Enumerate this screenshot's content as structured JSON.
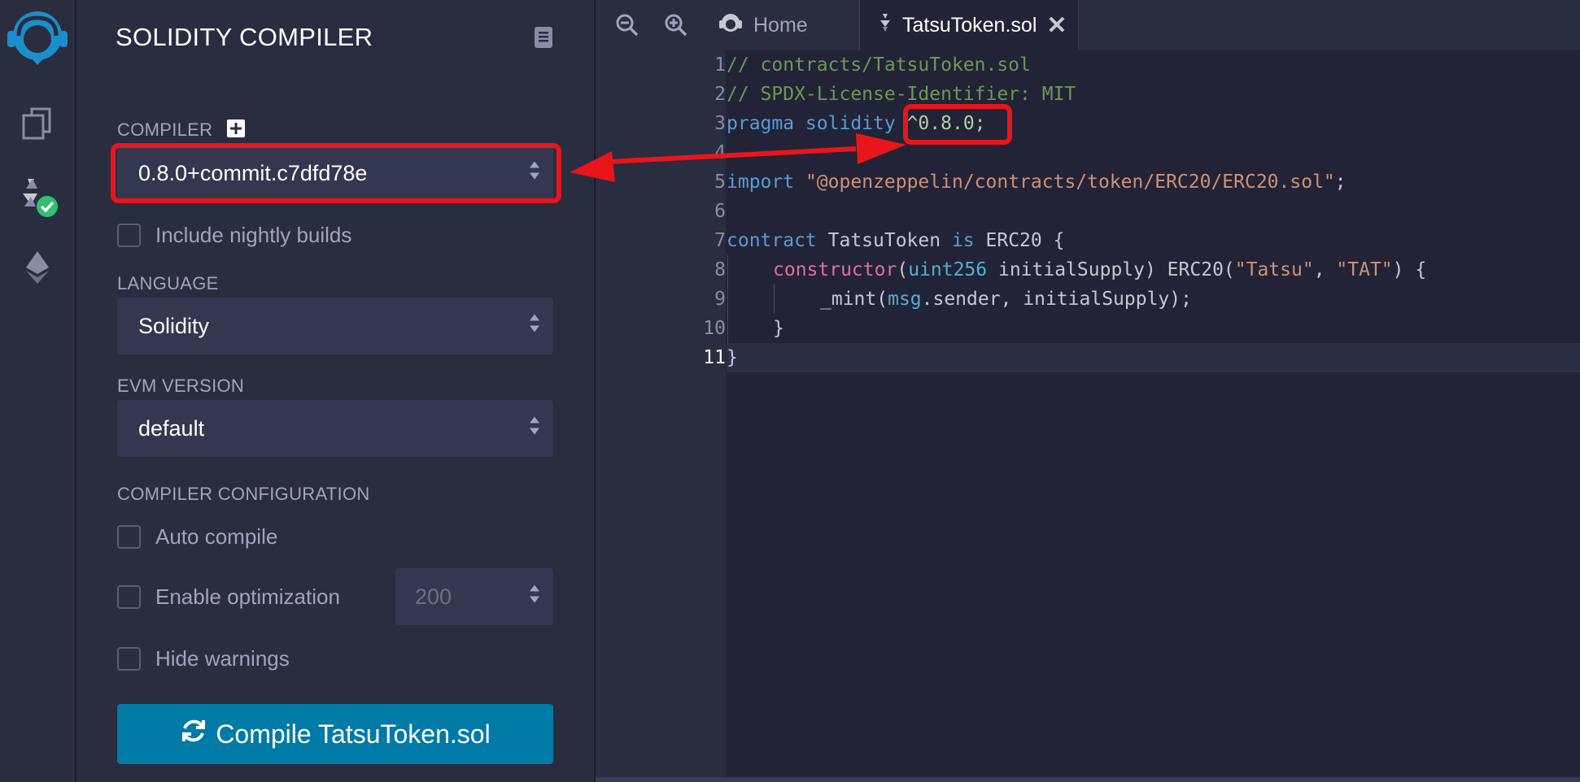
{
  "side_panel": {
    "title": "SOLIDITY COMPILER",
    "compiler_label": "COMPILER",
    "compiler_version": "0.8.0+commit.c7dfd78e",
    "nightly_label": "Include nightly builds",
    "language_label": "LANGUAGE",
    "language_value": "Solidity",
    "evm_label": "EVM VERSION",
    "evm_value": "default",
    "config_label": "COMPILER CONFIGURATION",
    "auto_compile_label": "Auto compile",
    "optimization_label": "Enable optimization",
    "optimization_runs": "200",
    "hide_warnings_label": "Hide warnings",
    "compile_button": "Compile TatsuToken.sol"
  },
  "tabs": {
    "home": "Home",
    "file": "TatsuToken.sol"
  },
  "editor": {
    "line_numbers": [
      "1",
      "2",
      "3",
      "4",
      "5",
      "6",
      "7",
      "8",
      "9",
      "10",
      "11"
    ],
    "line1": "// contracts/TatsuToken.sol",
    "line2": "// SPDX-License-Identifier: MIT",
    "line3_kw": "pragma solidity",
    "line3_ver": "^0.8.0;",
    "line5_kw": "import",
    "line5_str": "\"@openzeppelin/contracts/token/ERC20/ERC20.sol\"",
    "line5_end": ";",
    "line7_kw1": "contract",
    "line7_name": " TatsuToken ",
    "line7_kw2": "is",
    "line7_rest": " ERC20 {",
    "line8_fn": "constructor",
    "line8_p1": "(",
    "line8_type": "uint256",
    "line8_p2": " initialSupply) ERC20(",
    "line8_s1": "\"Tatsu\"",
    "line8_p3": ", ",
    "line8_s2": "\"TAT\"",
    "line8_p4": ") {",
    "line9_p1": "_mint(",
    "line9_msg": "msg",
    "line9_p2": ".sender, initialSupply);",
    "line10": "}",
    "line11": "}"
  },
  "colors": {
    "accent": "#007aa6",
    "highlight": "#e8151b",
    "check_ok": "#2fbf71"
  },
  "icons": [
    "remix-logo-icon",
    "file-explorer-icon",
    "solidity-compiler-icon",
    "deploy-run-icon",
    "docs-book-icon",
    "zoom-out-icon",
    "zoom-in-icon",
    "home-icon",
    "solidity-file-icon",
    "close-icon",
    "refresh-icon",
    "updown-icon"
  ]
}
